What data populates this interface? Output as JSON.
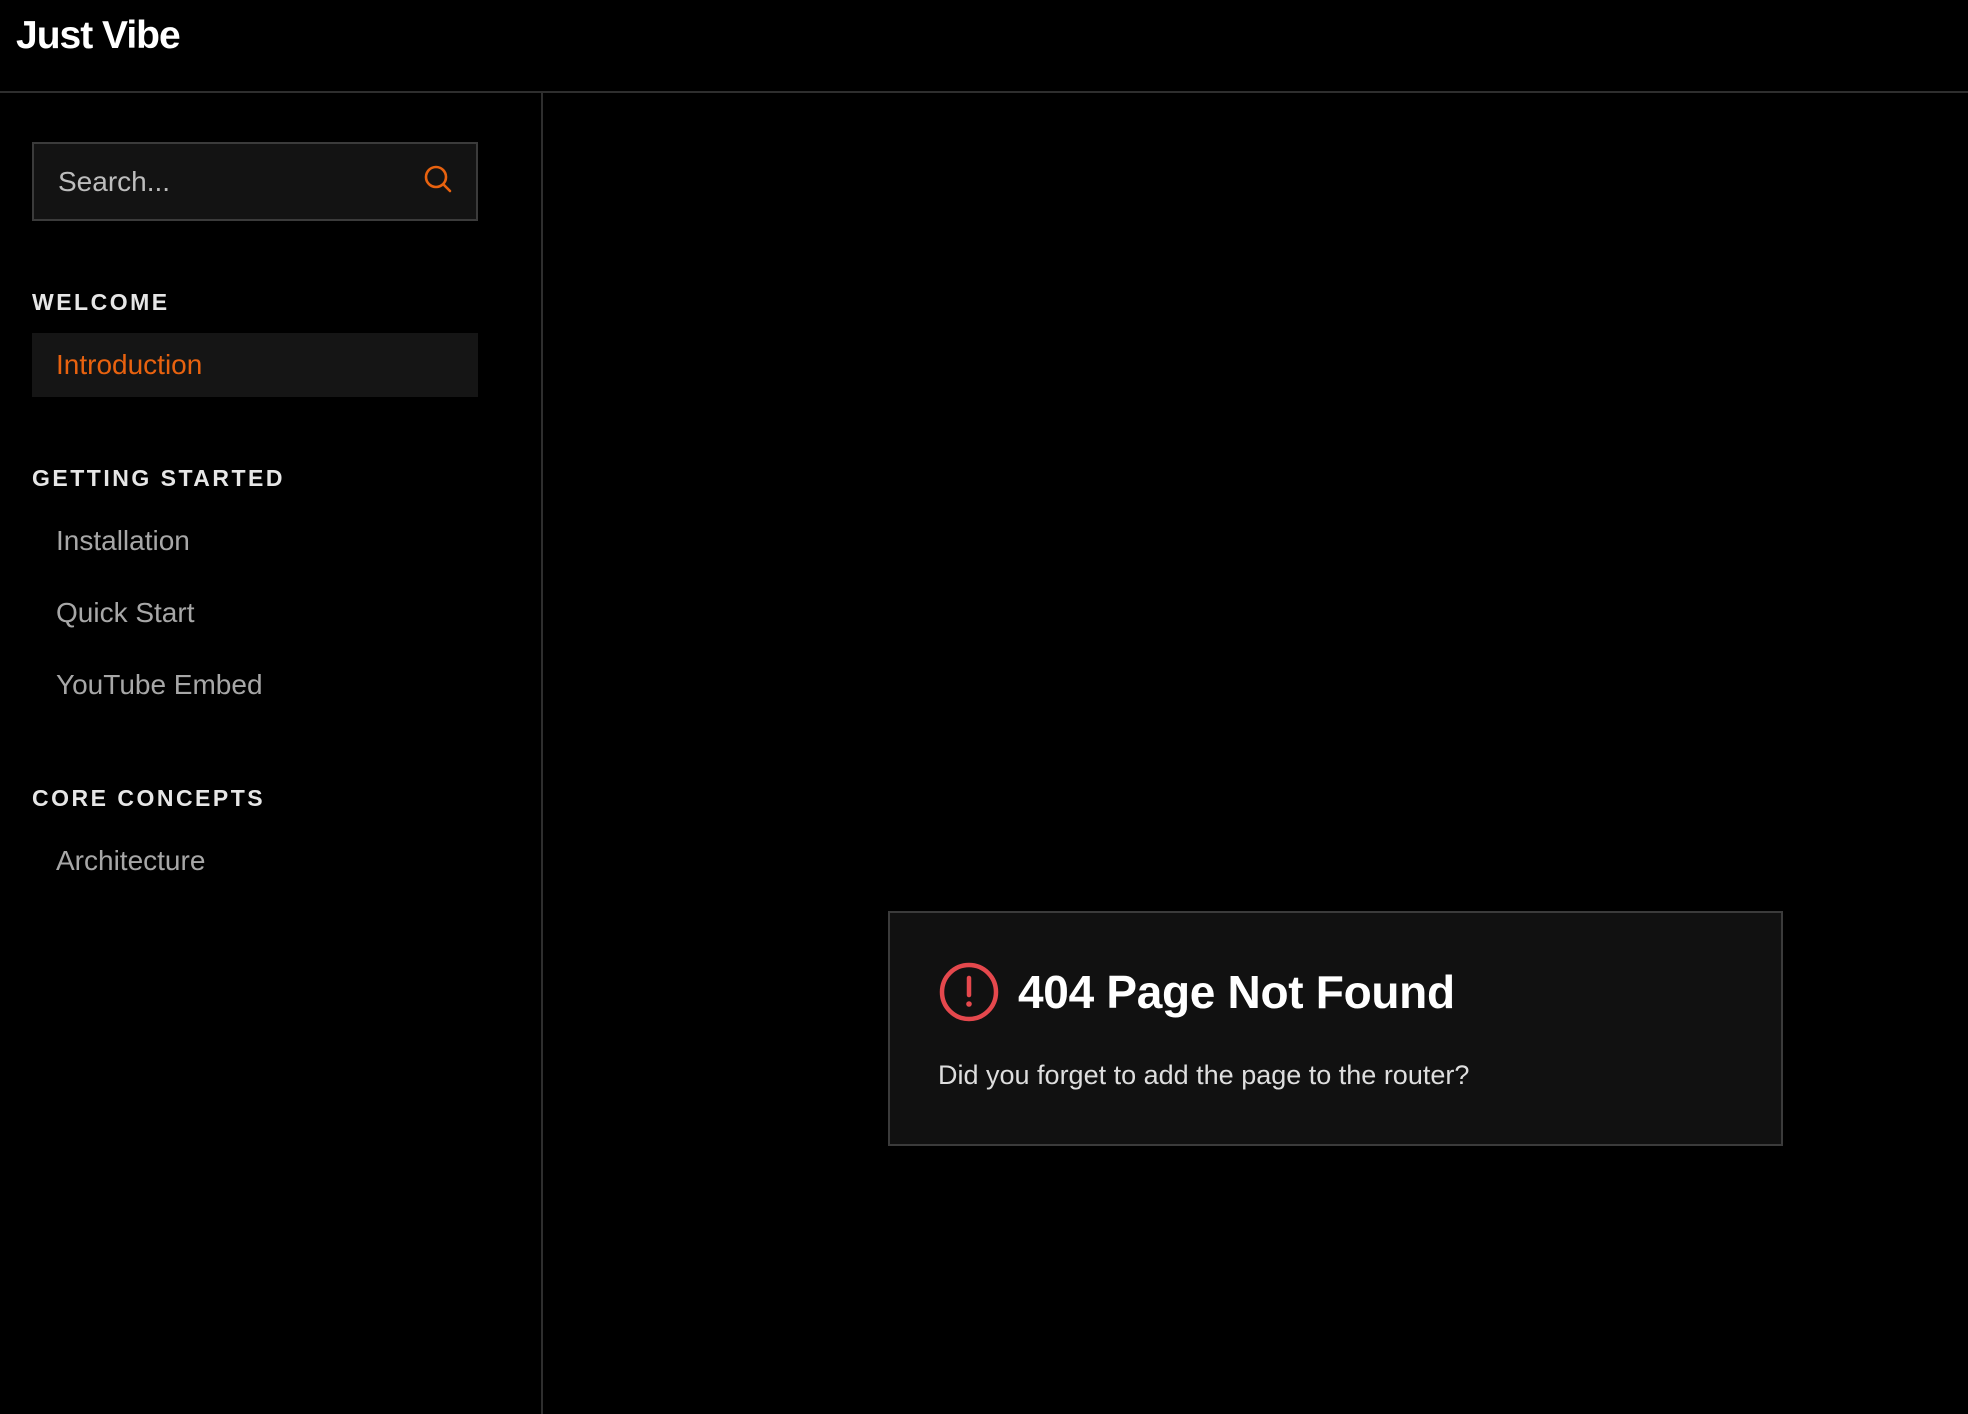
{
  "header": {
    "brand": "Just Vibe"
  },
  "sidebar": {
    "search": {
      "placeholder": "Search...",
      "icon": "search-icon"
    },
    "sections": [
      {
        "title": "WELCOME",
        "items": [
          {
            "label": "Introduction",
            "active": true
          }
        ]
      },
      {
        "title": "GETTING STARTED",
        "items": [
          {
            "label": "Installation",
            "active": false
          },
          {
            "label": "Quick Start",
            "active": false
          },
          {
            "label": "YouTube Embed",
            "active": false
          }
        ]
      },
      {
        "title": "CORE CONCEPTS",
        "items": [
          {
            "label": "Architecture",
            "active": false
          }
        ]
      }
    ]
  },
  "main": {
    "error": {
      "icon": "alert-circle-icon",
      "title": "404 Page Not Found",
      "message": "Did you forget to add the page to the router?"
    }
  },
  "colors": {
    "accent": "#e8620f",
    "error": "#e5484d",
    "background": "#000000",
    "card": "#111111",
    "border": "#3b3b3b"
  }
}
